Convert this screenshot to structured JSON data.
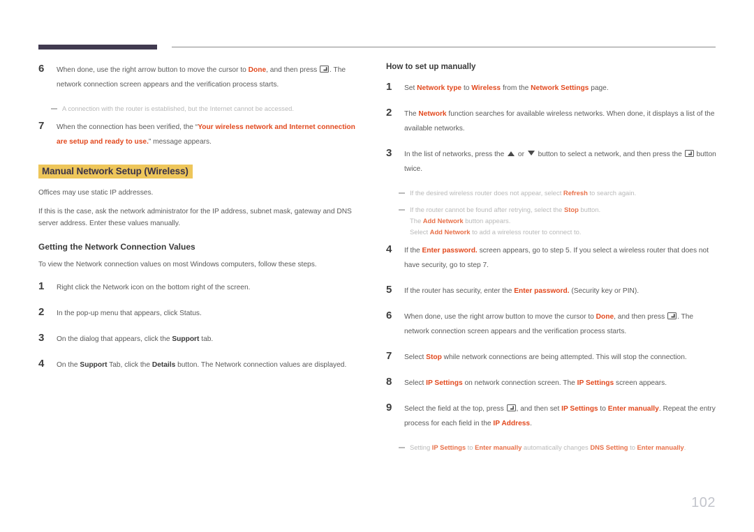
{
  "page": {
    "number": "102",
    "accent_orange": "#e2491e",
    "highlight_yellow": "#eec65a",
    "rule_dark": "#413a50",
    "note_gray": "#b9b9b9"
  },
  "left_column": {
    "steps_continued": [
      {
        "num": "6",
        "line1_a": "When done, use the right arrow button to move the cursor to ",
        "line1_em": "Done",
        "line1_b": ", and then press ",
        "line1_c": ". The",
        "line2": "network connection screen appears and the verification process starts."
      }
    ],
    "note_after_6": "A connection with the router is established, but the Internet cannot be accessed.",
    "step7": {
      "num": "7",
      "pre": "When the connection has been verified, the “",
      "em_line1": "Your wireless network and Internet connection",
      "em_line2": "are setup and ready to use.",
      "post": "” message appears."
    },
    "heading_highlight": "Manual Network Setup (Wireless)",
    "paragraphs": [
      "Offices may use static IP addresses.",
      "If this is the case, ask the network administrator for the IP address, subnet mask, gateway and DNS server address. Enter these values manually."
    ],
    "subheading": "Getting the Network Connection Values",
    "sub_intro": "To view the Network connection values on most Windows computers, follow these steps.",
    "sub_steps": [
      {
        "num": "1",
        "pre": "Right click the Network icon on the bottom right of the screen.",
        "bold1": "",
        "mid": "",
        "bold2": "",
        "post": ""
      },
      {
        "num": "2",
        "pre": "In the pop-up menu that appears, click Status.",
        "bold1": "",
        "mid": "",
        "bold2": "",
        "post": ""
      },
      {
        "num": "3",
        "pre": "On the dialog that appears, click the ",
        "bold1": "Support",
        "mid": " tab.",
        "bold2": "",
        "post": ""
      },
      {
        "num": "4",
        "pre": "On the ",
        "bold1": "Support",
        "mid": " Tab, click the ",
        "bold2": "Details",
        "post": " button. The Network connection values are displayed."
      }
    ]
  },
  "right_column": {
    "heading": "How to set up manually",
    "step1": {
      "num": "1",
      "a": "Set ",
      "em1": "Network type",
      "b": " to ",
      "em2": "Wireless",
      "c": " from the ",
      "em3": "Network Settings",
      "d": " page."
    },
    "step2": {
      "num": "2",
      "a": "The ",
      "em1": "Network",
      "b": " function searches for available wireless networks. When done, it displays a list of the",
      "line2": "available networks."
    },
    "step3": {
      "num": "3",
      "a": "In the list of networks, press the ",
      "b": " or ",
      "c": " button to select a network, and then press the ",
      "d": " button",
      "line2": "twice."
    },
    "notes_after_3": [
      {
        "a": "If the desired wireless router does not appear, select ",
        "em": "Refresh",
        "b": " to search again."
      },
      {
        "a": "If the router cannot be found after retrying, select the ",
        "em": "Stop",
        "b": " button."
      }
    ],
    "notes_sub": [
      {
        "a": "The ",
        "em": "Add Network",
        "b": " button appears."
      },
      {
        "a": "Select ",
        "em": "Add Network",
        "b": " to add a wireless router to connect to."
      }
    ],
    "step4": {
      "num": "4",
      "a": "If the ",
      "em1": "Enter password.",
      "b": " screen appears, go to step 5. If you select a wireless router that does not",
      "line2": "have security, go to step 7."
    },
    "step5": {
      "num": "5",
      "a": "If the router has security, enter the ",
      "em1": "Enter password.",
      "b": " (Security key or PIN)."
    },
    "step6": {
      "num": "6",
      "a": "When done, use the right arrow button to move the cursor to ",
      "em1": "Done",
      "b": ", and then press ",
      "c": ". The",
      "line2": "network connection screen appears and the verification process starts."
    },
    "step7": {
      "num": "7",
      "a": "Select ",
      "em1": "Stop",
      "b": " while network connections are being attempted. This will stop the connection."
    },
    "step8": {
      "num": "8",
      "a": "Select ",
      "em1": "IP Settings",
      "b": " on network connection screen. The ",
      "em2": "IP Settings",
      "c": " screen appears."
    },
    "step9": {
      "num": "9",
      "a": "Select the field at the top, press ",
      "b": ", and then set ",
      "em1": "IP Settings",
      "c": " to ",
      "em2": "Enter manually",
      "d": ". Repeat the entry",
      "line2_a": "process for each field in the ",
      "line2_em": "IP Address",
      "line2_b": "."
    },
    "note_final": {
      "a": "Setting ",
      "em1": "IP Settings",
      "b": " to ",
      "em2": "Enter manually",
      "c": " automatically changes ",
      "em3": "DNS Setting",
      "d": " to ",
      "em4": "Enter manually",
      "e": "."
    }
  }
}
